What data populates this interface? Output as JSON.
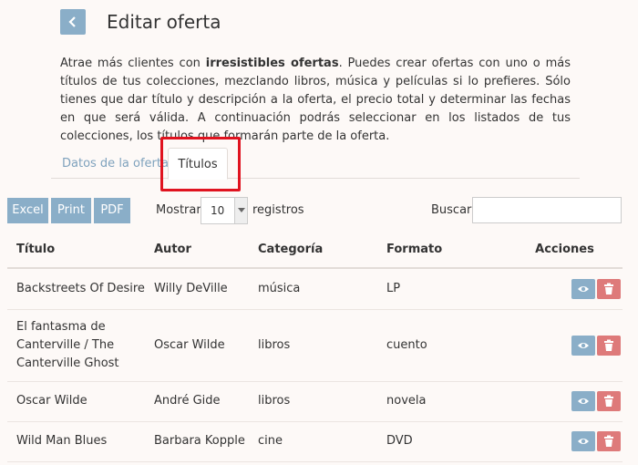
{
  "header": {
    "back_icon": "chevron-left-icon",
    "title": "Editar oferta"
  },
  "intro": {
    "lead": "Atrae más clientes con ",
    "bold": "irresistibles ofertas",
    "rest": ". Puedes crear ofertas con uno o más títulos de tus colecciones, mezclando libros, música y películas si lo prefieres. Sólo tienes que dar título y descripción a la oferta, el precio total y determinar las fechas en que será válida. A continuación podrás seleccionar en los listados de tus colecciones, los títulos que formarán parte de la oferta."
  },
  "tabs": [
    {
      "label": "Datos de la oferta",
      "active": false
    },
    {
      "label": "Títulos",
      "active": true
    }
  ],
  "toolbar": {
    "excel": "Excel",
    "print": "Print",
    "pdf": "PDF",
    "show_label": "Mostrar",
    "page_length": "10",
    "records_label": "registros",
    "search_label": "Buscar:",
    "search_value": ""
  },
  "table": {
    "headers": [
      "Título",
      "Autor",
      "Categoría",
      "Formato",
      "Acciones"
    ],
    "rows": [
      {
        "title": "Backstreets Of Desire",
        "author": "Willy DeVille",
        "category": "música",
        "format": "LP"
      },
      {
        "title": "El fantasma de Canterville / The Canterville Ghost",
        "author": "Oscar Wilde",
        "category": "libros",
        "format": "cuento"
      },
      {
        "title": "Oscar Wilde",
        "author": "André Gide",
        "category": "libros",
        "format": "novela"
      },
      {
        "title": "Wild Man Blues",
        "author": "Barbara Kopple",
        "category": "cine",
        "format": "DVD"
      }
    ]
  },
  "icons": {
    "view": "eye-icon",
    "delete": "trash-icon"
  },
  "colors": {
    "accent": "#8aaec8",
    "danger": "#de7a7a",
    "highlight": "#e0131f"
  }
}
